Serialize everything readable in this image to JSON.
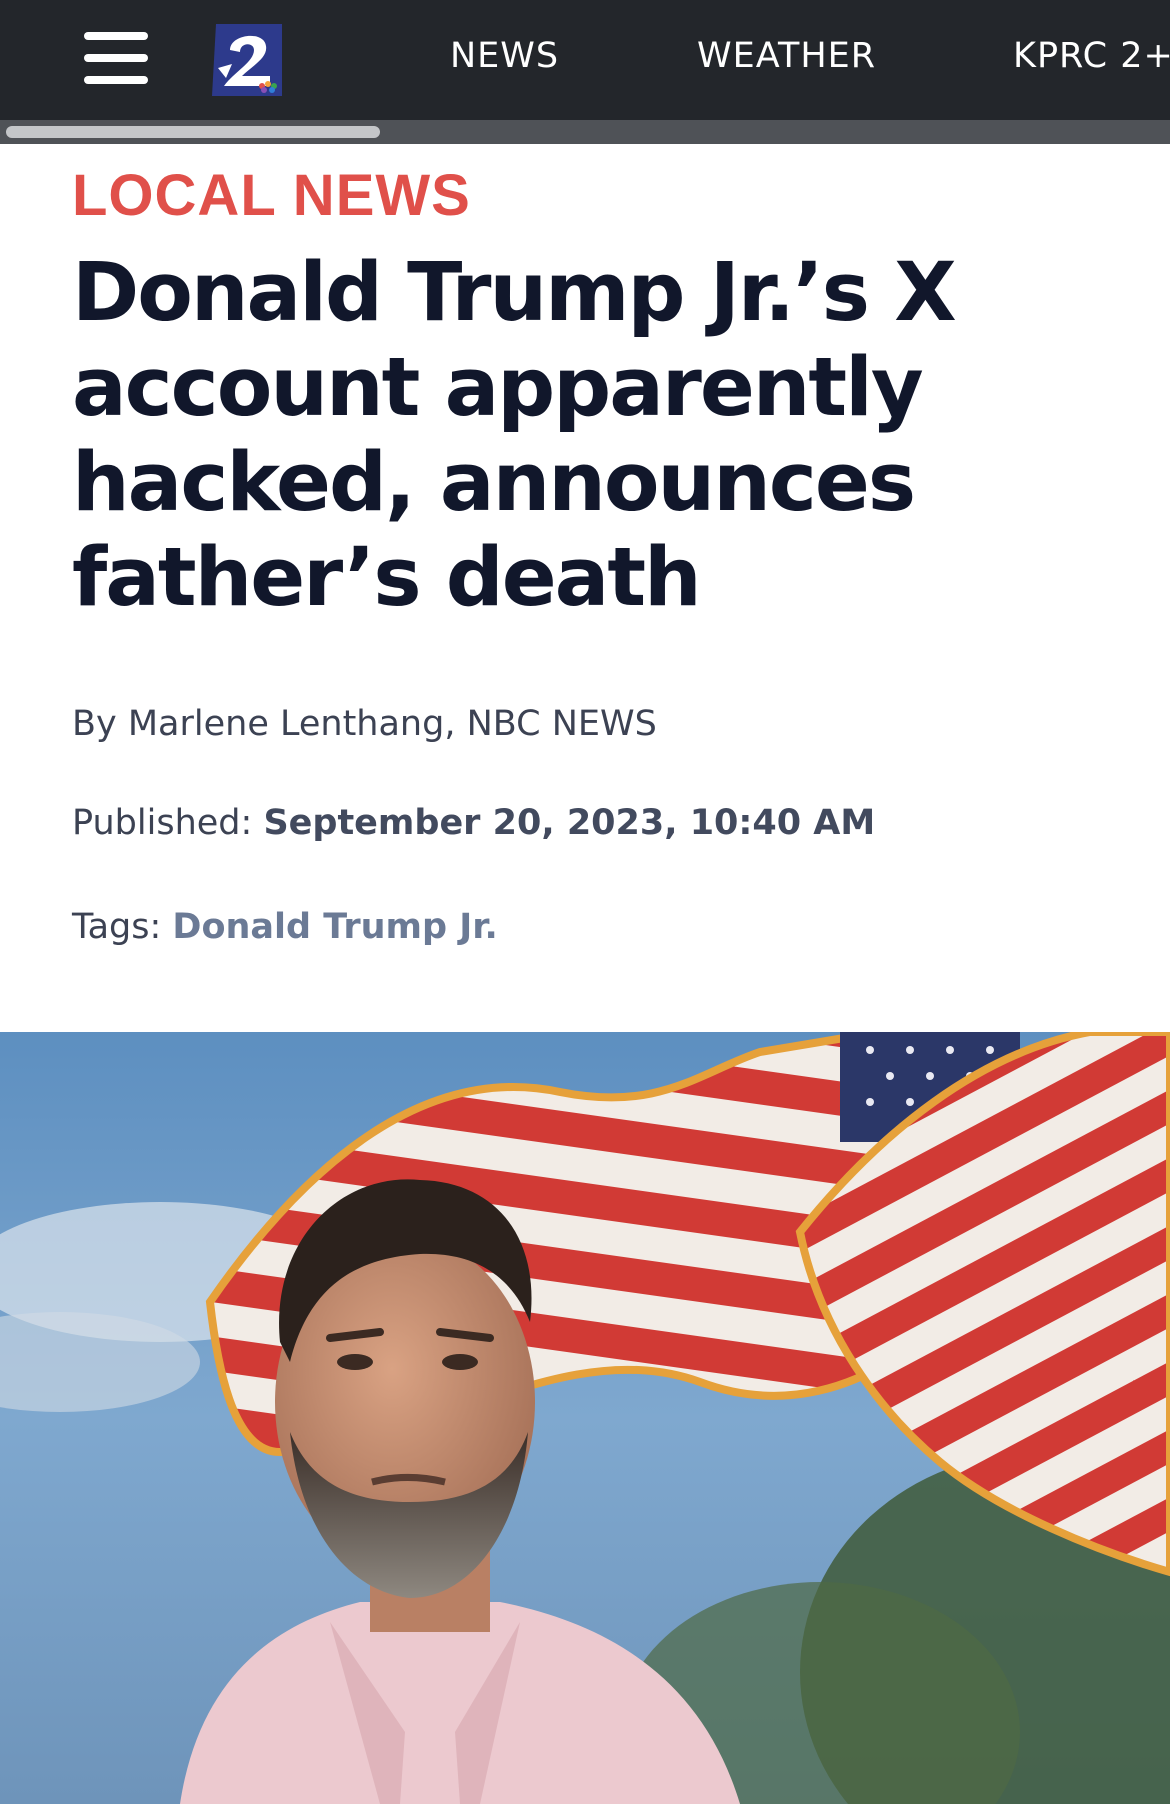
{
  "nav": {
    "items": [
      "NEWS",
      "WEATHER",
      "KPRC 2+"
    ]
  },
  "article": {
    "section": "LOCAL NEWS",
    "headline": "Donald Trump Jr.’s X account apparently hacked, announces father’s death",
    "byline": "By Marlene Lenthang, NBC NEWS",
    "published_label": "Published:",
    "published_date": "September 20, 2023, 10:40 AM",
    "tags_label": "Tags:",
    "tag": "Donald Trump Jr."
  },
  "colors": {
    "topbar": "#23262b",
    "section_red": "#e0504a",
    "headline_navy": "#11172b",
    "logo_blue": "#2d3a8c"
  },
  "icons": {
    "menu": "hamburger-icon",
    "logo": "kprc-2-logo"
  }
}
